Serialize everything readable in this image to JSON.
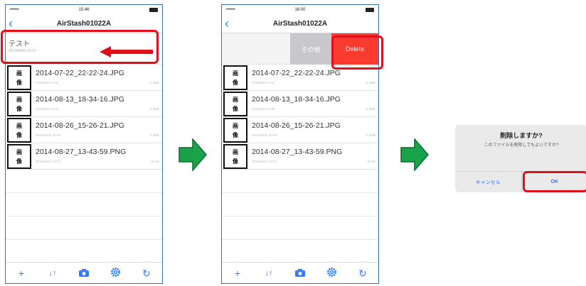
{
  "phone1": {
    "statusbar": {
      "carrier": "•••••• ",
      "time": "15:46"
    },
    "nav": {
      "back_icon": "chevron-left-icon",
      "title": "AirStash01022A"
    },
    "folder": {
      "name": "テスト",
      "date": "2014/08/20 15:17"
    },
    "files": [
      {
        "thumb_line1": "画",
        "thumb_line2": "像",
        "name": "2014-07-22_22-22-24.JPG",
        "date": "2014/08/21 4:51",
        "size": "1.4MB"
      },
      {
        "thumb_line1": "画",
        "thumb_line2": "像",
        "name": "2014-08-13_18-34-16.JPG",
        "date": "2014/08/21 5:02",
        "size": "1.5MB"
      },
      {
        "thumb_line1": "画",
        "thumb_line2": "像",
        "name": "2014-08-26_15-26-21.JPG",
        "date": "2014/08/26 15:29",
        "size": "2.3MB"
      },
      {
        "thumb_line1": "画",
        "thumb_line2": "像",
        "name": "2014-08-27_13-43-59.PNG",
        "date": "2014/08/27 13:47",
        "size": "34.1K"
      }
    ],
    "toolbar": {
      "add": "+",
      "sort": "↓↑",
      "camera_icon": "camera-icon",
      "settings_icon": "gear-icon",
      "refresh": "↻"
    }
  },
  "phone2": {
    "statusbar": {
      "carrier": "•••••• ",
      "time": "16:00"
    },
    "nav": {
      "back_icon": "chevron-left-icon",
      "title": "AirStash01022A"
    },
    "row_actions": {
      "more_label": "その他",
      "delete_label": "Delete"
    },
    "files": [
      {
        "thumb_line1": "画",
        "thumb_line2": "像",
        "name": "2014-07-22_22-22-24.JPG",
        "date": "2014/08/21 4:51",
        "size": "1.4MB"
      },
      {
        "thumb_line1": "画",
        "thumb_line2": "像",
        "name": "2014-08-13_18-34-16.JPG",
        "date": "2014/08/21 5:02",
        "size": "1.5MB"
      },
      {
        "thumb_line1": "画",
        "thumb_line2": "像",
        "name": "2014-08-26_15-26-21.JPG",
        "date": "2014/08/26 15:29",
        "size": "2.3MB"
      },
      {
        "thumb_line1": "画",
        "thumb_line2": "像",
        "name": "2014-08-27_13-43-59.PNG",
        "date": "2014/08/27 13:47",
        "size": "34.1K"
      }
    ],
    "toolbar": {
      "add": "+",
      "sort": "↓↑",
      "camera_icon": "camera-icon",
      "settings_icon": "gear-icon",
      "refresh": "↻"
    }
  },
  "alert": {
    "title": "削除しますか?",
    "message": "このファイルを削除してもよいですか?",
    "cancel_label": "キャンセル",
    "ok_label": "OK"
  },
  "colors": {
    "highlight": "#e0101a",
    "green_arrow": "#1aa24a",
    "ios_blue": "#2f7cf6",
    "delete_red": "#fb3b30"
  }
}
